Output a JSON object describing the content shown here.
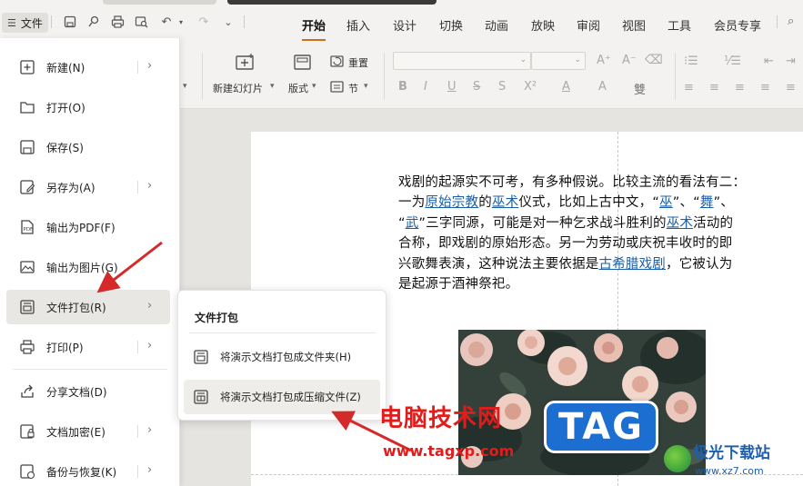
{
  "titlebar": {
    "file_label": "文件",
    "tabs": [
      "开始",
      "插入",
      "设计",
      "切换",
      "动画",
      "放映",
      "审阅",
      "视图",
      "工具",
      "会员专享"
    ],
    "active_tab": "开始"
  },
  "ribbon": {
    "new_slide": "新建幻灯片",
    "layout": "版式",
    "reset": "重置",
    "section": "节",
    "font_buttons": [
      "B",
      "I",
      "U",
      "S",
      "X²",
      "A",
      "A",
      "雙"
    ]
  },
  "file_menu": {
    "items": [
      {
        "label": "新建(N)",
        "icon": "new-file-icon",
        "submenu": true
      },
      {
        "label": "打开(O)",
        "icon": "folder-icon",
        "submenu": false
      },
      {
        "label": "保存(S)",
        "icon": "save-icon",
        "submenu": false
      },
      {
        "label": "另存为(A)",
        "icon": "save-as-icon",
        "submenu": true
      },
      {
        "label": "输出为PDF(F)",
        "icon": "pdf-icon",
        "submenu": false
      },
      {
        "label": "输出为图片(G)",
        "icon": "image-export-icon",
        "submenu": false
      },
      {
        "label": "文件打包(R)",
        "icon": "package-icon",
        "submenu": true
      },
      {
        "label": "打印(P)",
        "icon": "print-icon",
        "submenu": true
      },
      {
        "label": "分享文档(D)",
        "icon": "share-icon",
        "submenu": false
      },
      {
        "label": "文档加密(E)",
        "icon": "encrypt-icon",
        "submenu": true
      },
      {
        "label": "备份与恢复(K)",
        "icon": "backup-icon",
        "submenu": true
      }
    ]
  },
  "submenu": {
    "title": "文件打包",
    "items": [
      {
        "label": "将演示文档打包成文件夹(H)"
      },
      {
        "label": "将演示文档打包成压缩文件(Z)"
      }
    ]
  },
  "slide": {
    "lines": [
      [
        {
          "t": "戏剧的起源实不可考，有多种假说。比较主流的看法有二："
        }
      ],
      [
        {
          "t": "一为"
        },
        {
          "t": "原始宗教",
          "link": true
        },
        {
          "t": "的"
        },
        {
          "t": "巫术",
          "link": true
        },
        {
          "t": "仪式，比如上古中文，“"
        },
        {
          "t": "巫",
          "link": true
        },
        {
          "t": "”、“"
        },
        {
          "t": "舞",
          "link": true
        },
        {
          "t": "”、"
        }
      ],
      [
        {
          "t": "“"
        },
        {
          "t": "武",
          "link": true
        },
        {
          "t": "”三字同源，可能是对一种乞求战斗胜利的"
        },
        {
          "t": "巫术",
          "link": true
        },
        {
          "t": "活动的"
        }
      ],
      [
        {
          "t": "合称，即戏剧的原始形态。另一为劳动或庆祝丰收时的即"
        }
      ],
      [
        {
          "t": "兴歌舞表演，这种说法主要依据是"
        },
        {
          "t": "古希腊戏剧",
          "link": true
        },
        {
          "t": "，它被认为"
        }
      ],
      [
        {
          "t": "是起源于酒神祭祀。"
        }
      ]
    ]
  },
  "watermark": {
    "cn": "电脑技术网",
    "url": "www.tagxp.com",
    "tag": "TAG",
    "site_cn": "极光下载站",
    "site_url": "www.xz7.com"
  },
  "colors": {
    "accent": "#c8701e",
    "link": "#1a5fa8",
    "arrow": "#d42a2a"
  }
}
